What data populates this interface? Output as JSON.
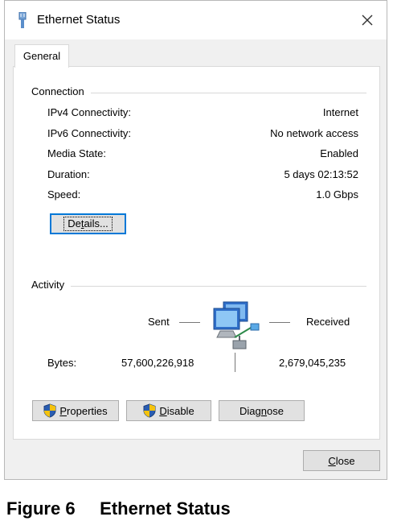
{
  "window": {
    "title": "Ethernet Status",
    "close_glyph": "✕"
  },
  "tabs": [
    {
      "label": "General"
    }
  ],
  "connection": {
    "group_label": "Connection",
    "rows": [
      {
        "label": "IPv4 Connectivity:",
        "value": "Internet"
      },
      {
        "label": "IPv6 Connectivity:",
        "value": "No network access"
      },
      {
        "label": "Media State:",
        "value": "Enabled"
      },
      {
        "label": "Duration:",
        "value": "5 days 02:13:52"
      },
      {
        "label": "Speed:",
        "value": "1.0 Gbps"
      }
    ],
    "details_button": {
      "pre": "De",
      "underlined": "t",
      "post": "ails..."
    }
  },
  "activity": {
    "group_label": "Activity",
    "sent_label": "Sent",
    "received_label": "Received",
    "bytes_label": "Bytes:",
    "bytes_sent": "57,600,226,918",
    "bytes_received": "2,679,045,235"
  },
  "buttons": {
    "properties": {
      "underlined": "P",
      "post": "roperties",
      "icon": "shield-icon"
    },
    "disable": {
      "underlined": "D",
      "post": "isable",
      "icon": "shield-icon"
    },
    "diagnose": {
      "pre": "Diag",
      "underlined": "n",
      "post": "ose"
    },
    "close": {
      "underlined": "C",
      "post": "lose"
    }
  },
  "caption": {
    "figure": "Figure 6",
    "title": "Ethernet Status"
  },
  "colors": {
    "focus_blue": "#0078d7",
    "shield_blue": "#2a5db0",
    "shield_yellow": "#f4c20d"
  }
}
